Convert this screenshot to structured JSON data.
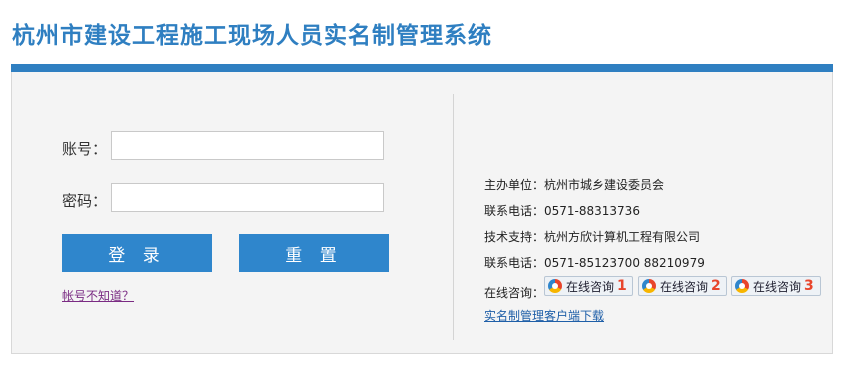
{
  "app": {
    "title": "杭州市建设工程施工现场人员实名制管理系统"
  },
  "login": {
    "account_label": "账号：",
    "account_value": "",
    "password_label": "密码：",
    "password_value": "",
    "login_button": "登 录",
    "reset_button": "重 置",
    "forgot_link": "帐号不知道？"
  },
  "info": {
    "organizer": "主办单位：杭州市城乡建设委员会",
    "phone1": "联系电话：0571-88313736",
    "support": "技术支持：杭州方欣计算机工程有限公司",
    "phone2": "联系电话：0571-85123700 88210979",
    "consult_label": "在线咨询：",
    "consult_buttons": [
      {
        "label": "在线咨询",
        "num": "1"
      },
      {
        "label": "在线咨询",
        "num": "2"
      },
      {
        "label": "在线咨询",
        "num": "3"
      }
    ],
    "download_link": "实名制管理客户端下载"
  },
  "colors": {
    "accent": "#2f7fc1",
    "button": "#2f86cc",
    "link": "#1f5fa8",
    "visited": "#7a2b83"
  }
}
